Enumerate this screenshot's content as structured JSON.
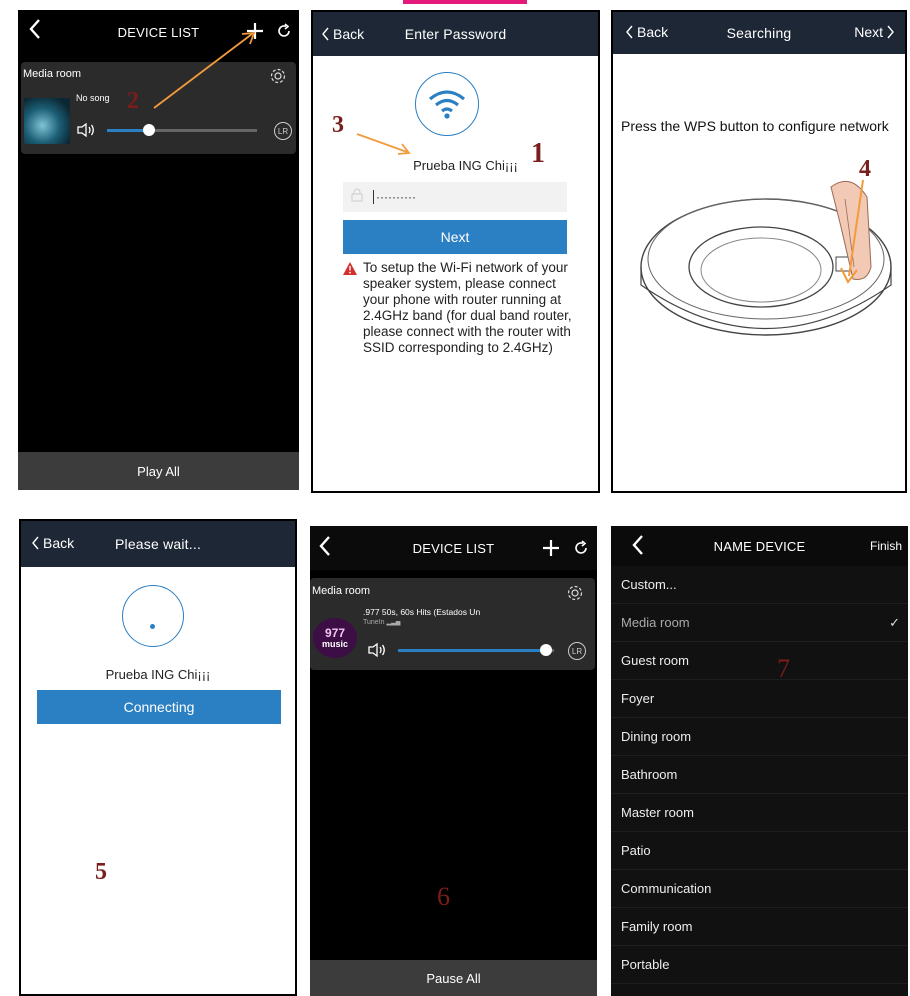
{
  "panel1": {
    "title": "DEVICE LIST",
    "device_name": "Media room",
    "song": "No song",
    "lr_badge": "LR",
    "footer_button": "Play All",
    "volume_level": 0.28,
    "marker": "2"
  },
  "panel2": {
    "back_label": "Back",
    "title": "Enter Password",
    "ssid": "Prueba ING Chi¡¡¡",
    "password_mask": "··········",
    "next_button": "Next",
    "warning_text": "To setup the Wi-Fi network of your speaker system, please connect your phone with router running at 2.4GHz band (for dual band router, please connect with the router with SSID corresponding to 2.4GHz)",
    "marker_3": "3",
    "marker_1": "1"
  },
  "panel3": {
    "back_label": "Back",
    "title": "Searching",
    "next_label": "Next",
    "instruction": "Press the WPS button to configure network",
    "marker": "4"
  },
  "panel4": {
    "back_label": "Back",
    "title": "Please wait...",
    "ssid": "Prueba ING Chi¡¡¡",
    "connecting_button": "Connecting",
    "marker": "5"
  },
  "panel5": {
    "title": "DEVICE LIST",
    "device_name": "Media room",
    "station": ".977 50s, 60s Hits (Estados Un",
    "source": "TuneIn",
    "logo_number": "977",
    "logo_word": "music",
    "lr_badge": "LR",
    "footer_button": "Pause All",
    "volume_level": 0.95,
    "marker": "6"
  },
  "panel6": {
    "title": "NAME DEVICE",
    "finish_label": "Finish",
    "check_mark": "✓",
    "items": [
      "Custom...",
      "Media room",
      "Guest room",
      "Foyer",
      "Dining room",
      "Bathroom",
      "Master room",
      "Patio",
      "Communication",
      "Family room",
      "Portable"
    ],
    "selected_index": 1,
    "marker": "7"
  },
  "colors": {
    "accent_blue": "#2b7fc3",
    "arrow_orange": "#f39a3c",
    "marker_red": "#7a1d1d",
    "nav_dark": "#1d2735",
    "warning_red": "#d32f2f"
  }
}
